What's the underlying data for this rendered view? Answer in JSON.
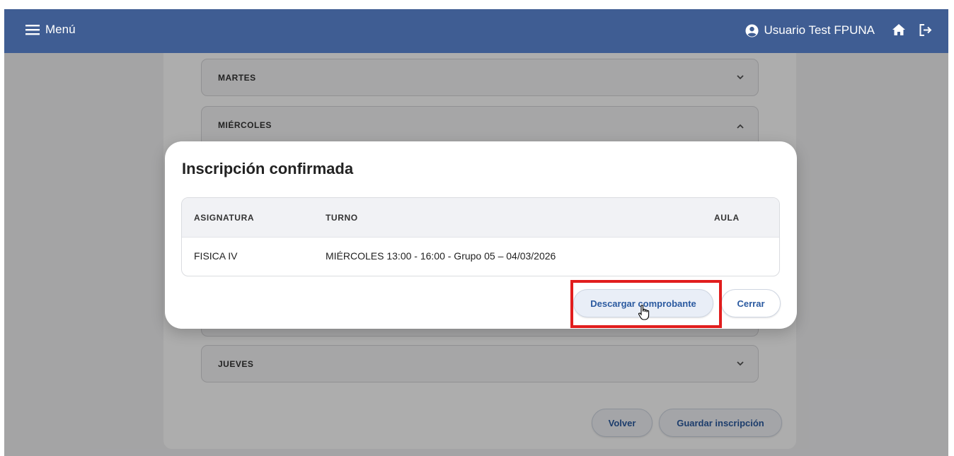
{
  "header": {
    "menu_label": "Menú",
    "user_name": "Usuario Test FPUNA",
    "colors": {
      "bar": "#3f5d93",
      "text": "#ffffff"
    }
  },
  "days": {
    "martes": "MARTES",
    "miercoles": "MIÉRCOLES",
    "jueves": "JUEVES"
  },
  "footer": {
    "back_label": "Volver",
    "save_label": "Guardar inscripción"
  },
  "modal": {
    "title": "Inscripción confirmada",
    "columns": {
      "subject": "ASIGNATURA",
      "shift": "TURNO",
      "room": "AULA"
    },
    "rows": [
      {
        "subject": "FISICA IV",
        "shift": "MIÉRCOLES 13:00 - 16:00 - Grupo 05 – 04/03/2026",
        "room": ""
      }
    ],
    "download_label": "Descargar comprobante",
    "close_label": "Cerrar",
    "accent_color": "#2b5aa0",
    "highlight_color": "#e11d1d"
  }
}
